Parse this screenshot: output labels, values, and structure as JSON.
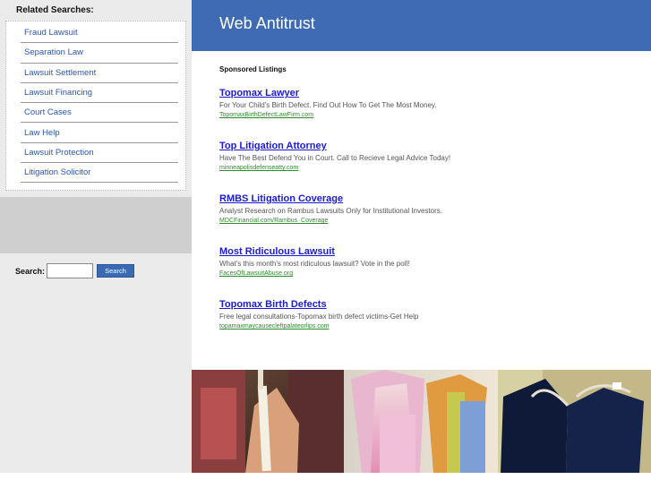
{
  "site": {
    "title": "Web Antitrust"
  },
  "sidebar": {
    "related_title": "Related Searches:",
    "items": [
      {
        "label": "Fraud Lawsuit"
      },
      {
        "label": "Separation Law"
      },
      {
        "label": "Lawsuit Settlement"
      },
      {
        "label": "Lawsuit Financing"
      },
      {
        "label": "Court Cases"
      },
      {
        "label": "Law Help"
      },
      {
        "label": "Lawsuit Protection"
      },
      {
        "label": "Litigation Solicitor"
      }
    ],
    "search": {
      "label": "Search:",
      "value": "",
      "placeholder": "",
      "button_label": "Search"
    }
  },
  "main": {
    "sponsored_label": "Sponsored Listings",
    "listings": [
      {
        "title": "Topomax Lawyer",
        "description": "For Your Child's Birth Defect. Find Out How To Get The Most Money.",
        "url": "TopomaxBirthDefectLawFirm.com"
      },
      {
        "title": "Top Litigation Attorney",
        "description": "Have The Best Defend You in Court. Call to Recieve Legal Advice Today!",
        "url": "minneapolisdefenseatty.com"
      },
      {
        "title": "RMBS Litigation Coverage",
        "description": "Analyst Research on Rambus Lawsuits Only for Institutional Investors.",
        "url": "MDCFinancial.com/Rambus_Coverage"
      },
      {
        "title": "Most Ridiculous Lawsuit",
        "description": "What's this month's most ridiculous lawsuit? Vote in the poll!",
        "url": "FacesOfLawsuitAbuse.org"
      },
      {
        "title": "Topomax Birth Defects",
        "description": "Free legal consultations-Topomax birth defect victims-Get Help",
        "url": "topamaxmaycausecleftpalateorlips.com"
      }
    ]
  },
  "colors": {
    "header": "#3f6bb5",
    "link": "#1a1adb",
    "url": "#2e8b2e",
    "sidebar_link": "#2b55b3",
    "button": "#3a6ab3"
  },
  "icons": {
    "photo": "clothing-rack-photo"
  }
}
